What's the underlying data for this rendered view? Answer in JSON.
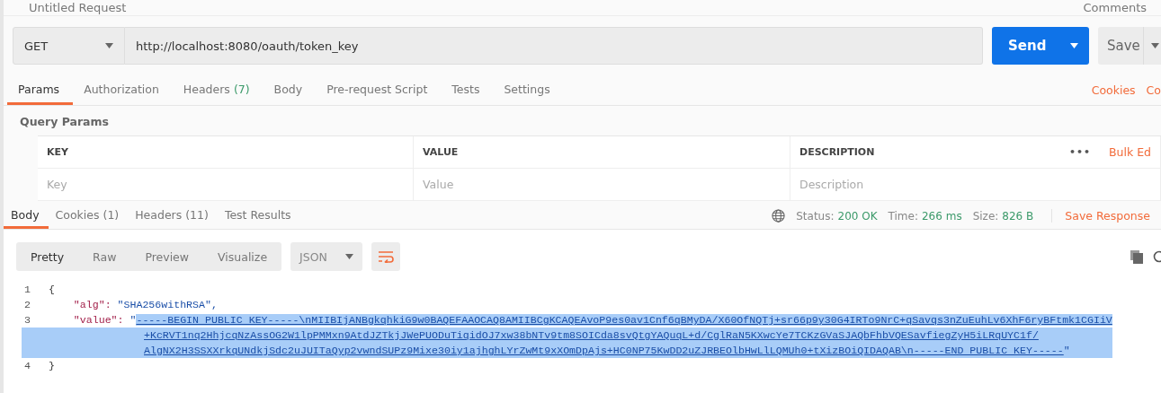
{
  "header": {
    "title": "Untitled Request",
    "comments": "Comments"
  },
  "request": {
    "method": "GET",
    "url": "http://localhost:8080/oauth/token_key",
    "send": "Send",
    "save": "Save"
  },
  "request_tabs": [
    {
      "label": "Params",
      "selected": true
    },
    {
      "label": "Authorization",
      "selected": false
    },
    {
      "label": "Headers",
      "count": "(7)",
      "selected": false
    },
    {
      "label": "Body",
      "selected": false
    },
    {
      "label": "Pre-request Script",
      "selected": false
    },
    {
      "label": "Tests",
      "selected": false
    },
    {
      "label": "Settings",
      "selected": false
    }
  ],
  "request_links": [
    "Cookies",
    "Co"
  ],
  "query_params": {
    "title": "Query Params",
    "columns": [
      "KEY",
      "VALUE",
      "DESCRIPTION"
    ],
    "placeholders": [
      "Key",
      "Value",
      "Description"
    ],
    "more": "•••",
    "bulk_edit": "Bulk Ed"
  },
  "response_tabs": [
    {
      "label": "Body",
      "selected": true
    },
    {
      "label": "Cookies",
      "count": "(1)",
      "selected": false
    },
    {
      "label": "Headers",
      "count": "(11)",
      "selected": false
    },
    {
      "label": "Test Results",
      "selected": false
    }
  ],
  "status": {
    "status_label": "Status:",
    "status": "200 OK",
    "time_label": "Time:",
    "time": "266 ms",
    "size_label": "Size:",
    "size": "826 B",
    "save_response": "Save Response"
  },
  "view_modes": [
    {
      "label": "Pretty",
      "selected": true
    },
    {
      "label": "Raw",
      "selected": false
    },
    {
      "label": "Preview",
      "selected": false
    },
    {
      "label": "Visualize",
      "selected": false
    }
  ],
  "format": "JSON",
  "code": [
    {
      "number": "1",
      "text": "{"
    },
    {
      "number": "2",
      "key": "\"alg\":",
      "value": "\"SHA256withRSA\","
    },
    {
      "number": "3",
      "key": "\"value\":",
      "open": "\"",
      "selected": true,
      "lines": [
        "-----BEGIN PUBLIC KEY-----\\nMIIBIjANBgkqhkiG9w0BAQEFAAOCAQ8AMIIBCgKCAQEAvoP9es0av1Cnf6qBMyDA/X60OfNQTj+sr66p9y30G4IRTo9NrC+qSavqs3nZuEuhLv6XhF6ryBFtmk1CGIiV",
        "+KcRVT1nq2HhjcqNzAssOG2W1lpPMMxn9AtdJZTkjJWePUODuTiqidOJ7xw38bNTv9tm8SOICda8svQtgYAQuqL+d/CglRaN5KXwcYe7TCKzGVaSJAQbFhbVQESavfiegZyH5iLRqUYC1f/",
        "AlgNX2H3SSXXrkqUNdkjSdc2uJUITaQyp2vwndSUPz9Mixe30iy1ajhghLYrZwMt9xXOmDpAjs+HC0NP75KwDD2uZJRBEOlbHwLlLQMUh0+tXizBOiQIDAQAB\\n-----END PUBLIC KEY-----"
      ],
      "close": "\""
    },
    {
      "number": "4",
      "text": "}"
    }
  ]
}
